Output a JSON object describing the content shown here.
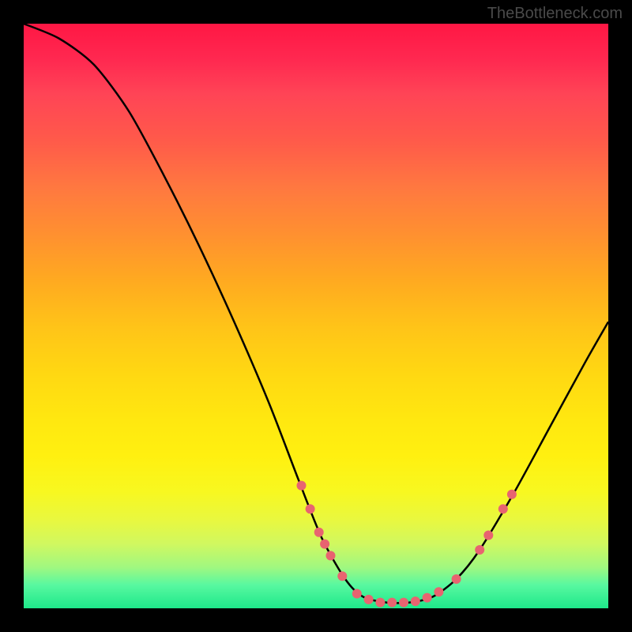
{
  "attribution": "TheBottleneck.com",
  "chart_data": {
    "type": "line",
    "title": "",
    "xlabel": "",
    "ylabel": "",
    "xlim": [
      0,
      100
    ],
    "ylim": [
      0,
      100
    ],
    "curve": {
      "name": "bottleneck-curve",
      "points": [
        {
          "x": 0,
          "y": 100
        },
        {
          "x": 6,
          "y": 97.5
        },
        {
          "x": 12,
          "y": 93
        },
        {
          "x": 18,
          "y": 85
        },
        {
          "x": 24,
          "y": 74
        },
        {
          "x": 30,
          "y": 62
        },
        {
          "x": 36,
          "y": 49
        },
        {
          "x": 42,
          "y": 35
        },
        {
          "x": 47,
          "y": 22
        },
        {
          "x": 51,
          "y": 12
        },
        {
          "x": 55,
          "y": 5
        },
        {
          "x": 58,
          "y": 2
        },
        {
          "x": 62,
          "y": 1
        },
        {
          "x": 66,
          "y": 1
        },
        {
          "x": 70,
          "y": 2
        },
        {
          "x": 74,
          "y": 5
        },
        {
          "x": 78,
          "y": 10
        },
        {
          "x": 84,
          "y": 20
        },
        {
          "x": 90,
          "y": 31
        },
        {
          "x": 96,
          "y": 42
        },
        {
          "x": 100,
          "y": 49
        }
      ]
    },
    "markers": {
      "name": "data-points",
      "color": "#e86470",
      "radius": 6,
      "points": [
        {
          "x": 47.5,
          "y": 21
        },
        {
          "x": 49,
          "y": 17
        },
        {
          "x": 50.5,
          "y": 13
        },
        {
          "x": 51.5,
          "y": 11
        },
        {
          "x": 52.5,
          "y": 9
        },
        {
          "x": 54.5,
          "y": 5.5
        },
        {
          "x": 57,
          "y": 2.5
        },
        {
          "x": 59,
          "y": 1.5
        },
        {
          "x": 61,
          "y": 1
        },
        {
          "x": 63,
          "y": 1
        },
        {
          "x": 65,
          "y": 1
        },
        {
          "x": 67,
          "y": 1.2
        },
        {
          "x": 69,
          "y": 1.8
        },
        {
          "x": 71,
          "y": 2.8
        },
        {
          "x": 74,
          "y": 5
        },
        {
          "x": 78,
          "y": 10
        },
        {
          "x": 79.5,
          "y": 12.5
        },
        {
          "x": 82,
          "y": 17
        },
        {
          "x": 83.5,
          "y": 19.5
        }
      ]
    },
    "gradient_stops": [
      {
        "pos": 0,
        "color": "#ff1744"
      },
      {
        "pos": 50,
        "color": "#ffd812"
      },
      {
        "pos": 100,
        "color": "#1ee88a"
      }
    ]
  }
}
